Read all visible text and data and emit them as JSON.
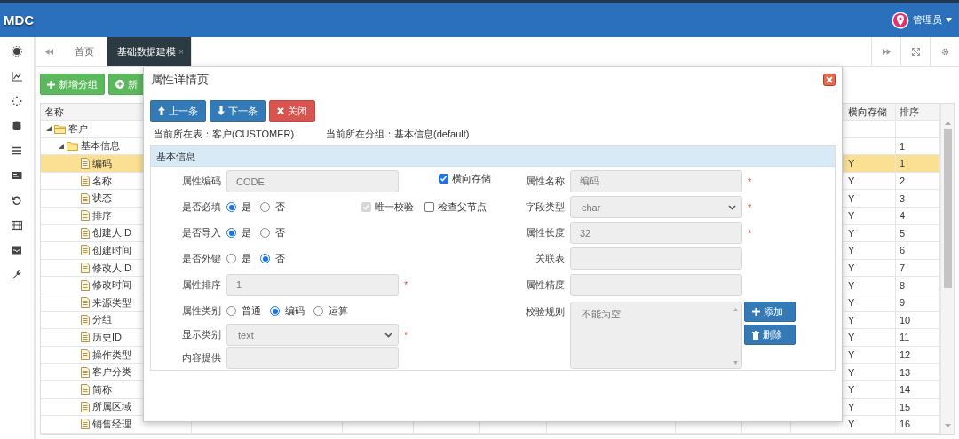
{
  "app": {
    "title": "MDC",
    "user": "管理员"
  },
  "tabs": [
    {
      "label": "首页",
      "selected": false
    },
    {
      "label": "基础数据建模",
      "selected": true,
      "close_mark": "×"
    }
  ],
  "toolbar": [
    {
      "label": "新增分组",
      "kind": "plus"
    },
    {
      "label": "新",
      "kind": "circle-plus"
    }
  ],
  "grid": {
    "name_column": "名称",
    "columns": [
      "横向存储",
      "排序"
    ],
    "tree": [
      {
        "name": "客户",
        "kind": "folder",
        "expanded": true,
        "selected": false,
        "children": [
          {
            "name": "基本信息",
            "kind": "folder",
            "expanded": true,
            "selected": false,
            "order": "1",
            "children": [
              {
                "name": "编码",
                "kind": "file",
                "selected": true,
                "horizontal_storage": "Y",
                "order": "1"
              },
              {
                "name": "名称",
                "kind": "file",
                "selected": false,
                "horizontal_storage": "Y",
                "order": "2"
              },
              {
                "name": "状态",
                "kind": "file",
                "selected": false,
                "horizontal_storage": "Y",
                "order": "3"
              },
              {
                "name": "排序",
                "kind": "file",
                "selected": false,
                "horizontal_storage": "Y",
                "order": "4"
              },
              {
                "name": "创建人ID",
                "kind": "file",
                "selected": false,
                "horizontal_storage": "Y",
                "order": "5"
              },
              {
                "name": "创建时间",
                "kind": "file",
                "selected": false,
                "horizontal_storage": "Y",
                "order": "6"
              },
              {
                "name": "修改人ID",
                "kind": "file",
                "selected": false,
                "horizontal_storage": "Y",
                "order": "7"
              },
              {
                "name": "修改时间",
                "kind": "file",
                "selected": false,
                "horizontal_storage": "Y",
                "order": "8"
              },
              {
                "name": "来源类型",
                "kind": "file",
                "selected": false,
                "horizontal_storage": "Y",
                "order": "9"
              },
              {
                "name": "分组",
                "kind": "file",
                "selected": false,
                "horizontal_storage": "Y",
                "order": "10"
              },
              {
                "name": "历史ID",
                "kind": "file",
                "selected": false,
                "horizontal_storage": "Y",
                "order": "11"
              },
              {
                "name": "操作类型",
                "kind": "file",
                "selected": false,
                "horizontal_storage": "Y",
                "order": "12"
              },
              {
                "name": "客户分类",
                "kind": "file",
                "selected": false,
                "horizontal_storage": "Y",
                "order": "13"
              },
              {
                "name": "简称",
                "kind": "file",
                "selected": false,
                "horizontal_storage": "Y",
                "order": "14"
              },
              {
                "name": "所属区域",
                "kind": "file",
                "selected": false,
                "horizontal_storage": "Y",
                "order": "15"
              },
              {
                "name": "销售经理",
                "kind": "file",
                "selected": false,
                "horizontal_storage": "Y",
                "order": "16"
              }
            ]
          }
        ]
      }
    ]
  },
  "dialog": {
    "title": "属性详情页",
    "buttons": [
      {
        "label": "上一条",
        "kind": "up"
      },
      {
        "label": "下一条",
        "kind": "down"
      },
      {
        "label": "关闭",
        "kind": "close"
      }
    ],
    "info": [
      "当前所在表：客户(CUSTOMER)",
      "当前所在分组：基本信息(default)"
    ],
    "section": "基本信息",
    "left_fields": [
      {
        "label": "属性编码",
        "kind": "text",
        "value": "CODE"
      },
      {
        "label": "是否必填",
        "kind": "radio",
        "options": [
          {
            "label": "是",
            "selected": true
          },
          {
            "label": "否",
            "selected": false
          }
        ]
      },
      {
        "label": "是否导入",
        "kind": "radio",
        "options": [
          {
            "label": "是",
            "selected": true
          },
          {
            "label": "否",
            "selected": false
          }
        ]
      },
      {
        "label": "是否外键",
        "kind": "radio",
        "options": [
          {
            "label": "是",
            "selected": false
          },
          {
            "label": "否",
            "selected": true
          }
        ]
      },
      {
        "label": "属性排序",
        "kind": "text",
        "value": "1",
        "required_mark": "*"
      },
      {
        "label": "属性类别",
        "kind": "radio",
        "options": [
          {
            "label": "普通",
            "selected": false
          },
          {
            "label": "编码",
            "selected": true
          },
          {
            "label": "运算",
            "selected": false
          }
        ]
      },
      {
        "label": "显示类别",
        "kind": "select",
        "value": "text",
        "required_mark": "*"
      },
      {
        "label": "内容提供",
        "kind": "text"
      }
    ],
    "checkboxes": [
      {
        "label": "横向存储",
        "checked": true,
        "disabled": false
      },
      {
        "label": "唯一校验",
        "checked": true,
        "disabled": true
      },
      {
        "label": "检查父节点",
        "checked": false,
        "disabled": false
      }
    ],
    "right_fields": [
      {
        "label": "属性名称",
        "kind": "text",
        "value": "编码",
        "required_mark": "*"
      },
      {
        "label": "字段类型",
        "kind": "select",
        "value": "char",
        "required_mark": "*"
      },
      {
        "label": "属性长度",
        "kind": "text",
        "value": "32",
        "required_mark": "*"
      },
      {
        "label": "关联表",
        "kind": "text"
      },
      {
        "label": "属性精度",
        "kind": "text"
      },
      {
        "label": "校验规则",
        "kind": "list",
        "value": "不能为空"
      }
    ],
    "rule_buttons": [
      {
        "label": "添加",
        "kind": "add"
      },
      {
        "label": "删除",
        "kind": "delete"
      }
    ]
  }
}
